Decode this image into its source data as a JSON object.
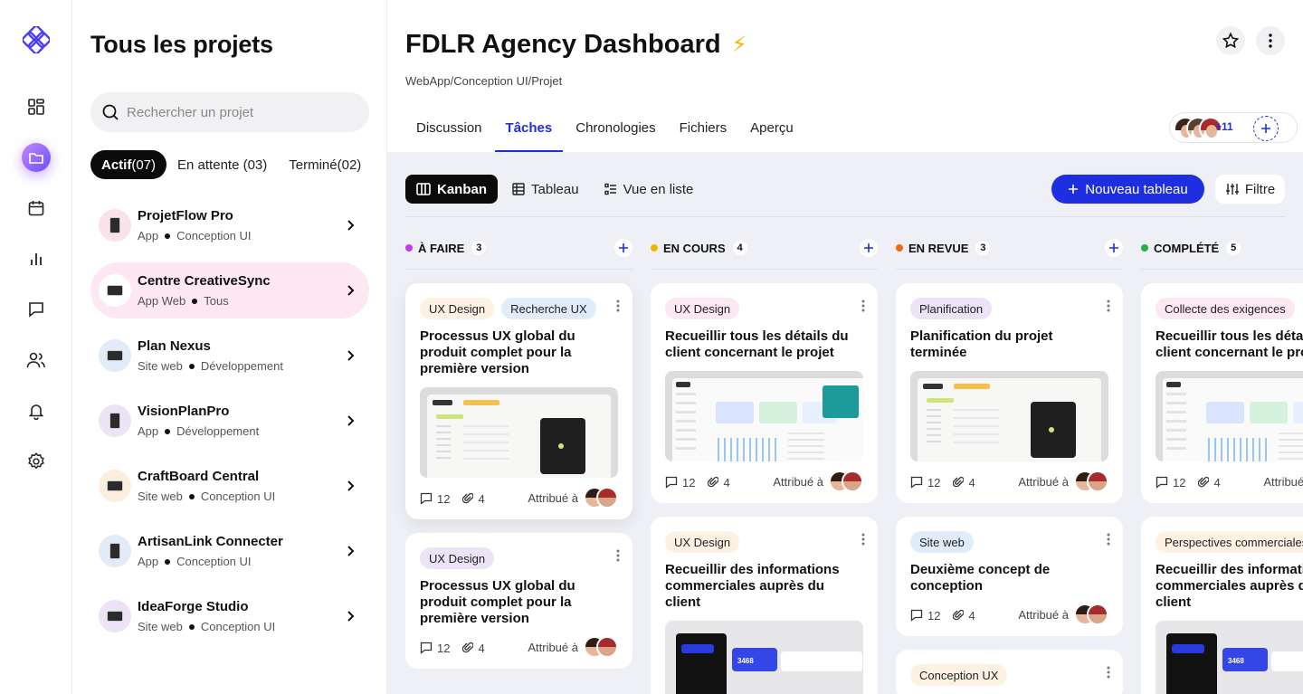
{
  "sidebar": {
    "title": "Tous les projets",
    "search_placeholder": "Rechercher un projet",
    "filters": {
      "active_label": "Actif",
      "active_count": "(07)",
      "pending": "En attente (03)",
      "done": "Terminé(02)"
    },
    "projects": [
      {
        "name": "ProjetFlow Pro",
        "type": "App",
        "category": "Conception UI",
        "device": "phone",
        "bg": "#f9e2ec"
      },
      {
        "name": "Centre CreativeSync",
        "type": "App Web",
        "category": "Tous",
        "device": "monitor",
        "bg": "#ffffff"
      },
      {
        "name": "Plan Nexus",
        "type": "Site web",
        "category": "Développement",
        "device": "monitor",
        "bg": "#e2ecf9"
      },
      {
        "name": "VisionPlanPro",
        "type": "App",
        "category": "Développement",
        "device": "phone",
        "bg": "#ece4f6"
      },
      {
        "name": "CraftBoard Central",
        "type": "Site web",
        "category": "Conception UI",
        "device": "monitor",
        "bg": "#fbeedf"
      },
      {
        "name": "ArtisanLink Connecter",
        "type": "App",
        "category": "Conception UI",
        "device": "phone",
        "bg": "#e2ecf9"
      },
      {
        "name": "IdeaForge Studio",
        "type": "Site web",
        "category": "Conception UI",
        "device": "monitor",
        "bg": "#ece4f6"
      }
    ]
  },
  "header": {
    "title": "FDLR Agency Dashboard",
    "title_emoji": "⚡",
    "breadcrumb": "WebApp/Conception UI/Projet",
    "tabs": [
      "Discussion",
      "Tâches",
      "Chronologies",
      "Fichiers",
      "Aperçu"
    ],
    "active_tab": "Tâches",
    "team_more": "+11"
  },
  "board": {
    "views": [
      "Kanban",
      "Tableau",
      "Vue en liste"
    ],
    "active_view": "Kanban",
    "new_button": "Nouveau tableau",
    "filter_button": "Filtre",
    "assigned_label": "Attribué à",
    "columns": [
      {
        "name": "À FAIRE",
        "count": "3",
        "color": "#c23be6",
        "cards": [
          {
            "tags": [
              {
                "label": "UX Design",
                "bg": "#fdf1e4"
              },
              {
                "label": "Recherche UX",
                "bg": "#e1ecfb"
              }
            ],
            "title": "Processus UX global du produit complet pour la première version",
            "thumb": "calendar",
            "comments": "12",
            "files": "4"
          },
          {
            "tags": [
              {
                "label": "UX Design",
                "bg": "#ece4f6"
              }
            ],
            "title": "Processus UX global du produit complet pour la première version",
            "thumb": "",
            "comments": "12",
            "files": "4"
          }
        ]
      },
      {
        "name": "EN COURS",
        "count": "4",
        "color": "#f0b400",
        "cards": [
          {
            "tags": [
              {
                "label": "UX Design",
                "bg": "#fde7f2"
              }
            ],
            "title": "Recueillir tous les détails du client concernant le projet",
            "thumb": "dashboard",
            "comments": "12",
            "files": "4"
          },
          {
            "tags": [
              {
                "label": "UX Design",
                "bg": "#fdf1e4"
              }
            ],
            "title": "Recueillir des informations commerciales auprès du client",
            "thumb": "dark",
            "comments": "",
            "files": ""
          }
        ]
      },
      {
        "name": "EN REVUE",
        "count": "3",
        "color": "#ee6a1b",
        "cards": [
          {
            "tags": [
              {
                "label": "Planification",
                "bg": "#ece4f6"
              }
            ],
            "title": "Planification du projet terminée",
            "thumb": "calendar",
            "comments": "12",
            "files": "4"
          },
          {
            "tags": [
              {
                "label": "Site web",
                "bg": "#e1ecfb"
              }
            ],
            "title": "Deuxième concept de conception",
            "thumb": "",
            "comments": "12",
            "files": "4"
          },
          {
            "tags": [
              {
                "label": "Conception UX",
                "bg": "#fdf1e4"
              }
            ],
            "title": "",
            "thumb": "",
            "comments": "",
            "files": ""
          }
        ]
      },
      {
        "name": "COMPLÉTÉ",
        "count": "5",
        "color": "#22b14c",
        "cards": [
          {
            "tags": [
              {
                "label": "Collecte des exigences",
                "bg": "#fde7f2"
              }
            ],
            "title": "Recueillir tous les détails du client concernant le projet",
            "thumb": "dashboard",
            "comments": "12",
            "files": "4"
          },
          {
            "tags": [
              {
                "label": "Perspectives commerciales",
                "bg": "#fdf1e4"
              }
            ],
            "title": "Recueillir des informations commerciales auprès du client",
            "thumb": "dark",
            "comments": "",
            "files": ""
          }
        ]
      }
    ]
  }
}
